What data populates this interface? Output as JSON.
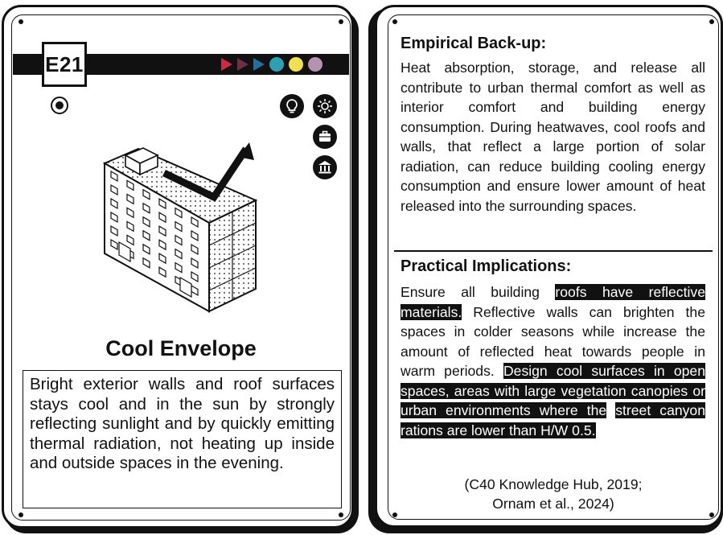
{
  "card_left": {
    "code": "E21",
    "indicator_colors": [
      "#d7263d",
      "#6d2e46",
      "#1e6fa8",
      "#2ba1b3",
      "#f4e04d",
      "#b791b0"
    ],
    "icons": [
      "lightbulb-icon",
      "sun-heat-icon",
      "briefcase-icon",
      "institution-icon"
    ],
    "title": "Cool Envelope",
    "description": "Bright exterior walls and roof surfaces stays cool and in the sun by strongly reflecting sunlight and by quickly emitting thermal radiation, not heating up inside and outside spaces in the evening."
  },
  "card_right": {
    "empirical_title": "Empirical Back-up:",
    "empirical_text": "Heat absorption, storage, and release all contribute to urban thermal comfort as well as interior comfort and building energy consumption. During heatwaves, cool roofs and walls, that reflect a large portion of solar radiation, can reduce building cooling energy consumption and ensure lower amount of heat released into the surrounding spaces.",
    "practical_title": "Practical Implications:",
    "practical_parts": {
      "p1": "Ensure all building ",
      "h1": "roofs have reflective materials.",
      "p2": " Reflective walls can brighten the spaces in colder seasons while increase the amount of reflected heat towards people in warm periods. ",
      "h2": "Design cool surfaces in open spaces, areas with large vegetation canopies or urban environments where the",
      "p3": " ",
      "h3": "street canyon rations are lower than H/W 0.5."
    },
    "citation_line1": "(C40 Knowledge Hub, 2019;",
    "citation_line2": "Ornam et al., 2024)"
  }
}
